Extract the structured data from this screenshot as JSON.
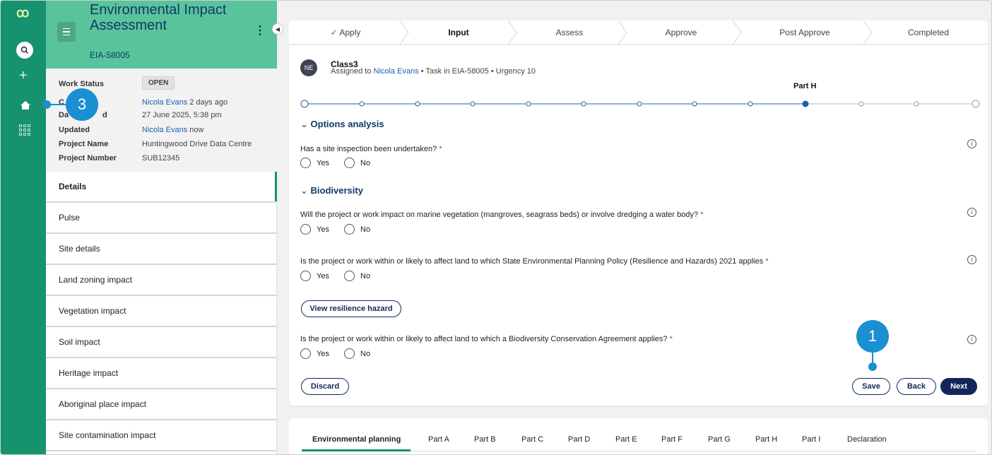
{
  "rail": {
    "logo": "ꝏ"
  },
  "sidebar": {
    "title": "Environmental Impact Assessment",
    "id": "EIA-58005",
    "meta": [
      {
        "key": "Work Status",
        "value": "OPEN"
      },
      {
        "key": "C",
        "value_link": "Nicola Evans",
        "value_rest": " 2 days ago"
      },
      {
        "key": "Da",
        "key2": "d",
        "value": "27 June 2025, 5:38 pm"
      },
      {
        "key": "Updated",
        "value_link": "Nicola Evans",
        "value_rest": " now"
      },
      {
        "key": "Project Name",
        "value": "Huntingwood Drive Data Centre"
      },
      {
        "key": "Project Number",
        "value": "SUB12345"
      }
    ],
    "nav": [
      "Details",
      "Pulse",
      "Site details",
      "Land zoning impact",
      "Vegetation impact",
      "Soil impact",
      "Heritage impact",
      "Aboriginal place impact",
      "Site contamination impact"
    ]
  },
  "stepper": {
    "steps": [
      "Apply",
      "Input",
      "Assess",
      "Approve",
      "Post Approve",
      "Completed"
    ],
    "current": "Input"
  },
  "task": {
    "avatar": "NE",
    "title": "Class3",
    "assigned_prefix": "Assigned to ",
    "assignee": "Nicola Evans",
    "details": " • Task in EIA-58005 • Urgency 10",
    "part_label": "Part H"
  },
  "sections": {
    "options": "Options analysis",
    "biodiversity": "Biodiversity"
  },
  "questions": [
    "Has a site inspection been undertaken?",
    "Will the project or work impact on marine vegetation (mangroves, seagrass beds) or involve dredging a water body?",
    "Is the project or work within or likely to affect land to which State Environmental Planning Policy (Resilience and Hazards) 2021 applies",
    "Is the project or work within or likely to affect land to which a Biodiversity Conservation Agreement applies?"
  ],
  "radio": {
    "yes": "Yes",
    "no": "No"
  },
  "required_mark": "*",
  "buttons": {
    "view_hazard": "View resilience hazard",
    "discard": "Discard",
    "save": "Save",
    "back": "Back",
    "next": "Next"
  },
  "tabs": [
    "Environmental planning",
    "Part A",
    "Part B",
    "Part C",
    "Part D",
    "Part E",
    "Part F",
    "Part G",
    "Part H",
    "Part I",
    "Declaration"
  ],
  "callouts": {
    "one": "1",
    "three": "3"
  },
  "colors": {
    "brand": "#17926f",
    "header": "#59c39b",
    "primary_button": "#13265c",
    "callout": "#1a8fd1",
    "link": "#1a5fb4"
  }
}
